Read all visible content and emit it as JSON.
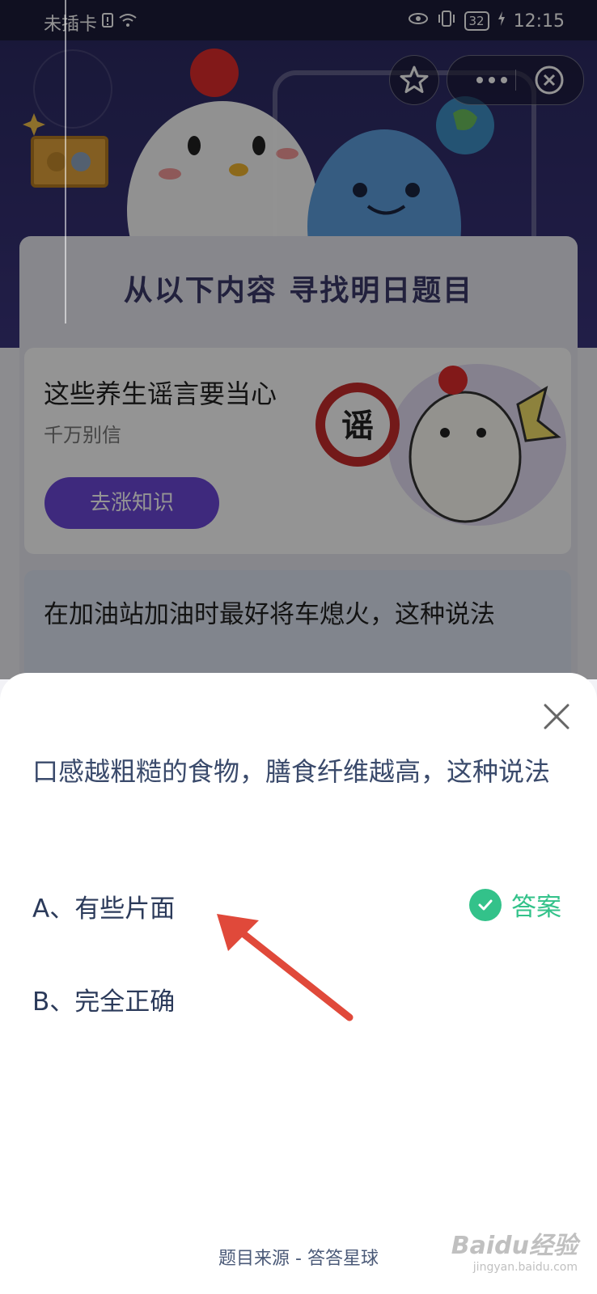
{
  "status_bar": {
    "carrier": "未插卡",
    "battery": "32",
    "time": "12:15"
  },
  "background": {
    "section_title": "从以下内容  寻找明日题目",
    "article": {
      "title": "这些养生谣言要当心",
      "subtitle": "千万别信",
      "button": "去涨知识",
      "sticker": "谣"
    },
    "quiz_preview": "在加油站加油时最好将车熄火，这种说法"
  },
  "sheet": {
    "question": "口感越粗糙的食物，膳食纤维越高，这种说法",
    "options": [
      {
        "label": "A、有些片面"
      },
      {
        "label": "B、完全正确"
      }
    ],
    "answer_label": "答案",
    "source": "题目来源 - 答答星球"
  },
  "watermark": {
    "main": "Baidu经验",
    "sub": "jingyan.baidu.com"
  },
  "colors": {
    "accent_purple": "#6c48d8",
    "answer_green": "#33c28a",
    "arrow_red": "#e0493a",
    "hero_dark": "#2c2a63"
  },
  "icons": [
    "signal-icon",
    "wifi-icon",
    "eye-icon",
    "vibrate-icon",
    "charging-icon",
    "star-icon",
    "more-icon",
    "close-circle-icon",
    "close-icon",
    "check-icon",
    "arrow-annotation"
  ]
}
